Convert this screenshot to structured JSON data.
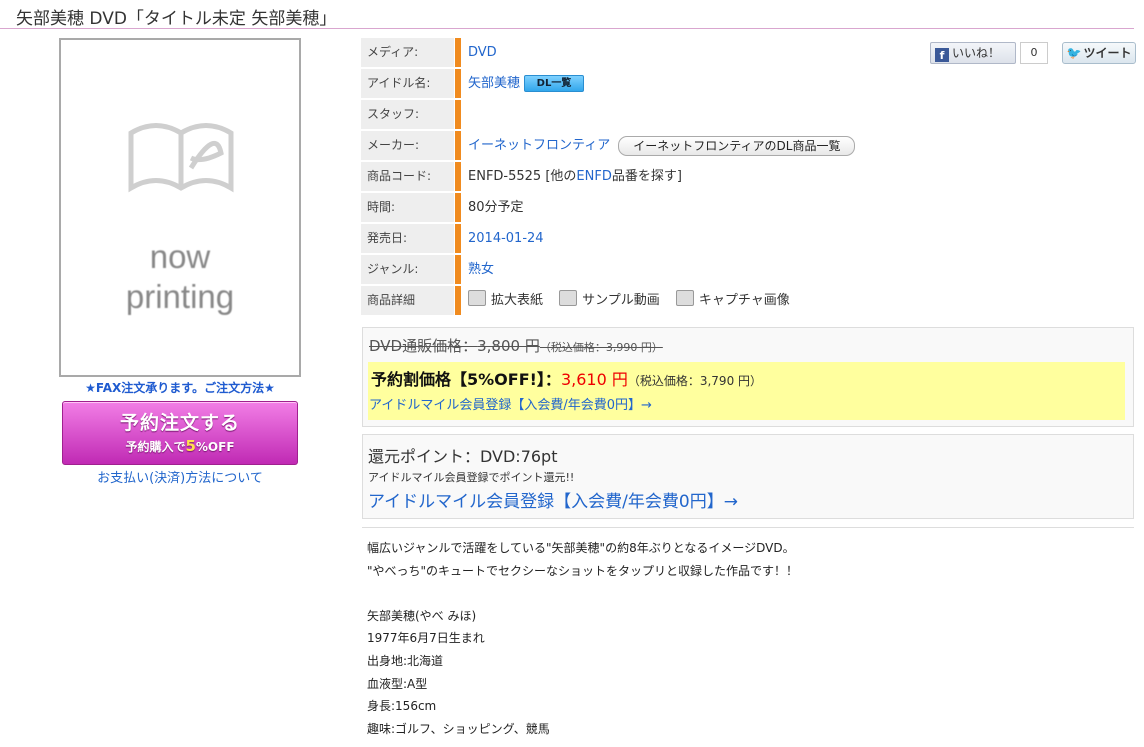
{
  "page_title": "矢部美穂  DVD「タイトル未定  矢部美穂」",
  "cover": {
    "line1": "now",
    "line2": "printing"
  },
  "fax_text": "★FAX注文承ります。ご注文方法★",
  "order_button": {
    "line1": "予約注文する",
    "line2_prefix": "予約購入で",
    "line2_num": "5",
    "line2_suffix": "%OFF"
  },
  "payment_link": "お支払い(決済)方法について",
  "info": {
    "media": {
      "label": "メディア:",
      "value": "DVD"
    },
    "idol": {
      "label": "アイドル名:",
      "value": "矢部美穂",
      "badge": "DL一覧"
    },
    "staff": {
      "label": "スタッフ:"
    },
    "maker": {
      "label": "メーカー:",
      "value": "イーネットフロンティア",
      "button": "イーネットフロンティアのDL商品一覧"
    },
    "code": {
      "label": "商品コード:",
      "value": "ENFD-5525",
      "bracket_pre": " [他の",
      "bracket_link": "ENFD",
      "bracket_post": "品番を探す]"
    },
    "time": {
      "label": "時間:",
      "value": "80分予定"
    },
    "release": {
      "label": "発売日:",
      "value": "2014-01-24"
    },
    "genre": {
      "label": "ジャンル:",
      "value": "熟女"
    },
    "details": {
      "label": "商品詳細",
      "items": [
        "拡大表紙",
        "サンプル動画",
        "キャプチャ画像"
      ]
    }
  },
  "social": {
    "like": "いいね！",
    "like_count": "0",
    "tweet": "ツイート"
  },
  "price": {
    "old_label": "DVD通販価格：",
    "old_value": "3,800 円",
    "old_tax": "（税込価格：3,990 円）",
    "sale_label": "予約割価格【5%OFF!】：",
    "sale_value": "3,610 円",
    "sale_tax": "（税込価格：3,790 円）",
    "mile_link": "アイドルマイル会員登録【入会費/年会費0円】→"
  },
  "points": {
    "label": "還元ポイント：DVD:76pt",
    "note": "アイドルマイル会員登録でポイント還元!!",
    "link": "アイドルマイル会員登録【入会費/年会費0円】→"
  },
  "description": [
    "幅広いジャンルで活躍をしている\"矢部美穂\"の約8年ぶりとなるイメージDVD。",
    "\"やべっち\"のキュートでセクシーなショットをタップリと収録した作品です！！",
    "",
    "矢部美穂(やべ みほ)",
    "1977年6月7日生まれ",
    "出身地:北海道",
    "血液型:A型",
    "身長:156cm",
    "趣味:ゴルフ、ショッピング、競馬"
  ],
  "colors": {
    "accent_bar": "#f08b1f",
    "link": "#2266cc",
    "sale_red": "#e00000",
    "highlight": "#ffff9e"
  }
}
